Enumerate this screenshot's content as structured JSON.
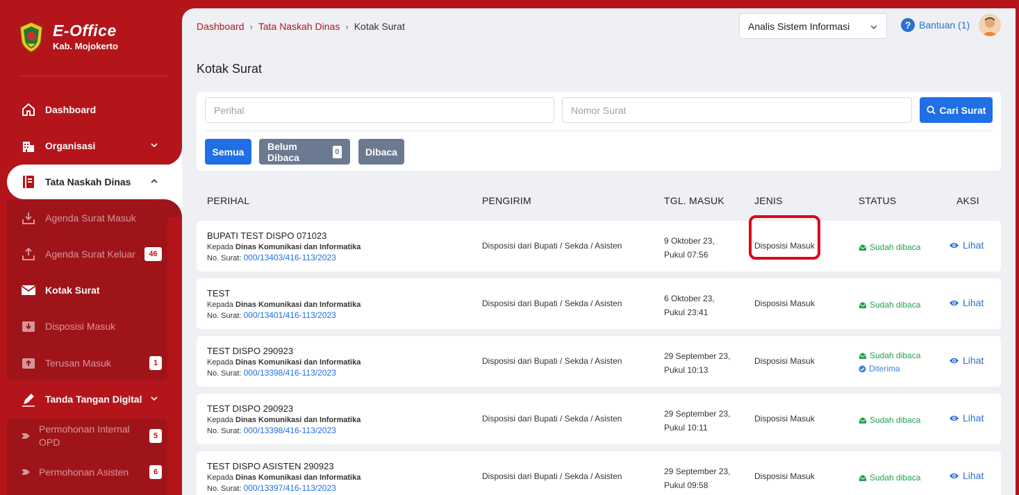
{
  "brand": {
    "title": "E-Office",
    "subtitle": "Kab. Mojokerto"
  },
  "nav": {
    "dashboard": "Dashboard",
    "organisasi": "Organisasi",
    "tata_naskah": "Tata Naskah Dinas",
    "tanda_tangan": "Tanda Tangan Digital"
  },
  "subnav": {
    "agenda_masuk": "Agenda Surat Masuk",
    "agenda_keluar": "Agenda Surat Keluar",
    "agenda_keluar_count": "46",
    "kotak_surat": "Kotak Surat",
    "disposisi_masuk": "Disposisi Masuk",
    "terusan_masuk": "Terusan Masuk",
    "terusan_masuk_count": "1",
    "permohonan_internal": "Permohonan Internal OPD",
    "permohonan_internal_count": "5",
    "permohonan_asisten": "Permohonan Asisten",
    "permohonan_asisten_count": "6"
  },
  "breadcrumb": {
    "home": "Dashboard",
    "section": "Tata Naskah Dinas",
    "current": "Kotak Surat"
  },
  "header": {
    "role": "Analis Sistem Informasi",
    "help": "Bantuan (1)"
  },
  "page_title": "Kotak Surat",
  "filter": {
    "perihal_placeholder": "Perihal",
    "nomor_placeholder": "Nomor Surat",
    "search_label": "Cari Surat",
    "tab_all": "Semua",
    "tab_unread": "Belum Dibaca",
    "tab_unread_count": "0",
    "tab_read": "Dibaca"
  },
  "table": {
    "headers": [
      "PERIHAL",
      "PENGIRIM",
      "TGL. MASUK",
      "JENIS",
      "STATUS",
      "AKSI"
    ],
    "kepada_prefix": "Kepada",
    "nomor_prefix": "No. Surat:",
    "rows": [
      {
        "perihal": "BUPATI TEST DISPO 071023",
        "kepada": "Dinas Komunikasi dan Informatika",
        "nomor": "000/13403/416-113/2023",
        "pengirim": "Disposisi dari Bupati / Sekda / Asisten",
        "tgl": "9 Oktober 23,",
        "jam": "Pukul 07:56",
        "jenis": "Disposisi Masuk",
        "status": "Sudah dibaca",
        "status2": "",
        "aksi": "Lihat"
      },
      {
        "perihal": "TEST",
        "kepada": "Dinas Komunikasi dan Informatika",
        "nomor": "000/13401/416-113/2023",
        "pengirim": "Disposisi dari Bupati / Sekda / Asisten",
        "tgl": "6 Oktober 23,",
        "jam": "Pukul 23:41",
        "jenis": "Disposisi Masuk",
        "status": "Sudah dibaca",
        "status2": "",
        "aksi": "Lihat"
      },
      {
        "perihal": "TEST DISPO 290923",
        "kepada": "Dinas Komunikasi dan Informatika",
        "nomor": "000/13398/416-113/2023",
        "pengirim": "Disposisi dari Bupati / Sekda / Asisten",
        "tgl": "29 September 23,",
        "jam": "Pukul 10:13",
        "jenis": "Disposisi Masuk",
        "status": "Sudah dibaca",
        "status2": "Diterima",
        "aksi": "Lihat"
      },
      {
        "perihal": "TEST DISPO 290923",
        "kepada": "Dinas Komunikasi dan Informatika",
        "nomor": "000/13398/416-113/2023",
        "pengirim": "Disposisi dari Bupati / Sekda / Asisten",
        "tgl": "29 September 23,",
        "jam": "Pukul 10:11",
        "jenis": "Disposisi Masuk",
        "status": "Sudah dibaca",
        "status2": "",
        "aksi": "Lihat"
      },
      {
        "perihal": "TEST DISPO ASISTEN 290923",
        "kepada": "Dinas Komunikasi dan Informatika",
        "nomor": "000/13397/416-113/2023",
        "pengirim": "Disposisi dari Bupati / Sekda / Asisten",
        "tgl": "29 September 23,",
        "jam": "Pukul 09:58",
        "jenis": "Disposisi Masuk",
        "status": "Sudah dibaca",
        "status2": "",
        "aksi": "Lihat"
      }
    ]
  },
  "colors": {
    "brand": "#b3151b",
    "primary": "#1f6fe5",
    "success": "#1ea24b",
    "highlight": "#e0001a"
  }
}
